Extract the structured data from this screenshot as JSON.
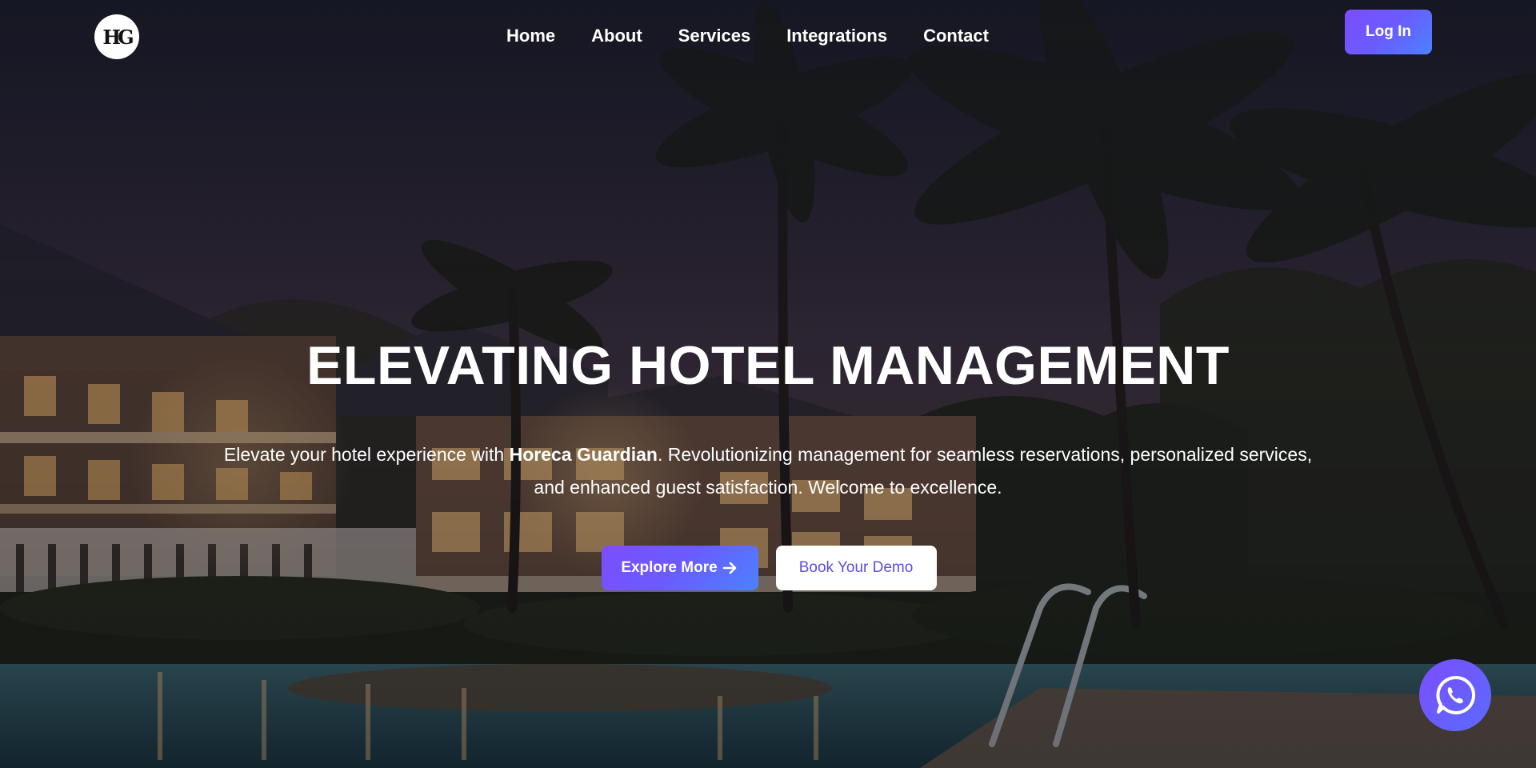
{
  "nav": {
    "logo_text": "HG",
    "links": [
      "Home",
      "About",
      "Services",
      "Integrations",
      "Contact"
    ],
    "login_label": "Log In"
  },
  "hero": {
    "title": "ELEVATING HOTEL MANAGEMENT",
    "desc_prefix": "Elevate your hotel experience with ",
    "brand": "Horeca Guardian",
    "desc_suffix": ". Revolutionizing management for seamless reservations, personalized services, and enhanced guest satisfaction. Welcome to excellence.",
    "explore_label": "Explore More",
    "demo_label": "Book Your Demo"
  },
  "icons": {
    "explore_arrow": "arrow-right-icon",
    "chat": "whatsapp-icon"
  },
  "colors": {
    "accent_start": "#7c4dff",
    "accent_end": "#4b82ff",
    "demo_text": "#5b4ee0"
  }
}
